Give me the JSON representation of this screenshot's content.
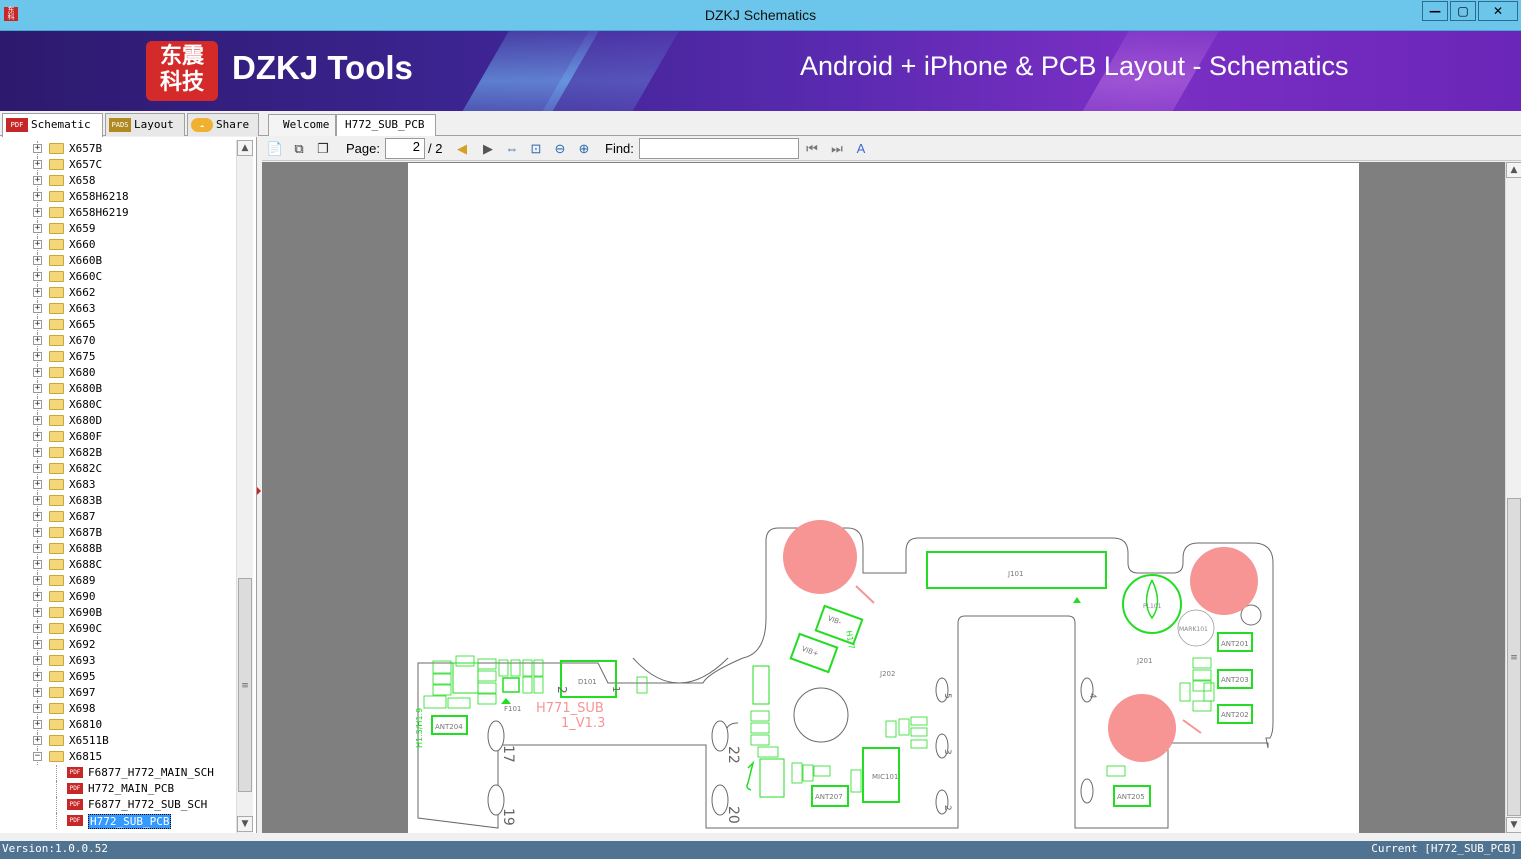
{
  "window": {
    "title": "DZKJ Schematics",
    "app_icon": "dzkj-logo-icon"
  },
  "banner": {
    "logo_text": "东震\n科技",
    "brand": "DZKJ Tools",
    "tagline": "Android + iPhone & PCB Layout - Schematics"
  },
  "main_tabs": [
    {
      "label": "Schematic",
      "icon": "PDF"
    },
    {
      "label": "Layout",
      "icon": "PADS"
    },
    {
      "label": "Share",
      "icon": "cloud-icon"
    }
  ],
  "doc_tabs": [
    {
      "label": "Welcome"
    },
    {
      "label": "H772_SUB_PCB"
    }
  ],
  "tree": {
    "folders": [
      "X657B",
      "X657C",
      "X658",
      "X658H6218",
      "X658H6219",
      "X659",
      "X660",
      "X660B",
      "X660C",
      "X662",
      "X663",
      "X665",
      "X670",
      "X675",
      "X680",
      "X680B",
      "X680C",
      "X680D",
      "X680F",
      "X682B",
      "X682C",
      "X683",
      "X683B",
      "X687",
      "X687B",
      "X688B",
      "X688C",
      "X689",
      "X690",
      "X690B",
      "X690C",
      "X692",
      "X693",
      "X695",
      "X697",
      "X698",
      "X6810",
      "X6511B",
      "X6815"
    ],
    "expanded_folder": "X6815",
    "files": [
      "F6877_H772_MAIN_SCH",
      "H772_MAIN_PCB",
      "F6877_H772_SUB_SCH",
      "H772_SUB_PCB"
    ],
    "selected_file": "H772_SUB_PCB"
  },
  "toolbar": {
    "page_label": "Page:",
    "page_current": "2",
    "page_total": "/ 2",
    "find_label": "Find:",
    "find_value": ""
  },
  "pcb": {
    "board_name": "H771_SUB",
    "board_version": "1_V1.3",
    "labels": [
      "J101",
      "J201",
      "J202",
      "D101",
      "MIC101",
      "ANT201",
      "ANT202",
      "ANT203",
      "ANT204",
      "ANT205",
      "ANT207",
      "MARK101",
      "PL101",
      "VIB-",
      "VIB+",
      "H1.7",
      "H1.3/H1.9",
      "F101",
      "22",
      "20",
      "17",
      "19",
      "2",
      "1",
      "4",
      "5",
      "3",
      "2"
    ],
    "trace_color": "#22dd22",
    "marker_color": "#f79494"
  },
  "status": {
    "version": "Version:1.0.0.52",
    "current": "Current [H772_SUB_PCB]"
  }
}
